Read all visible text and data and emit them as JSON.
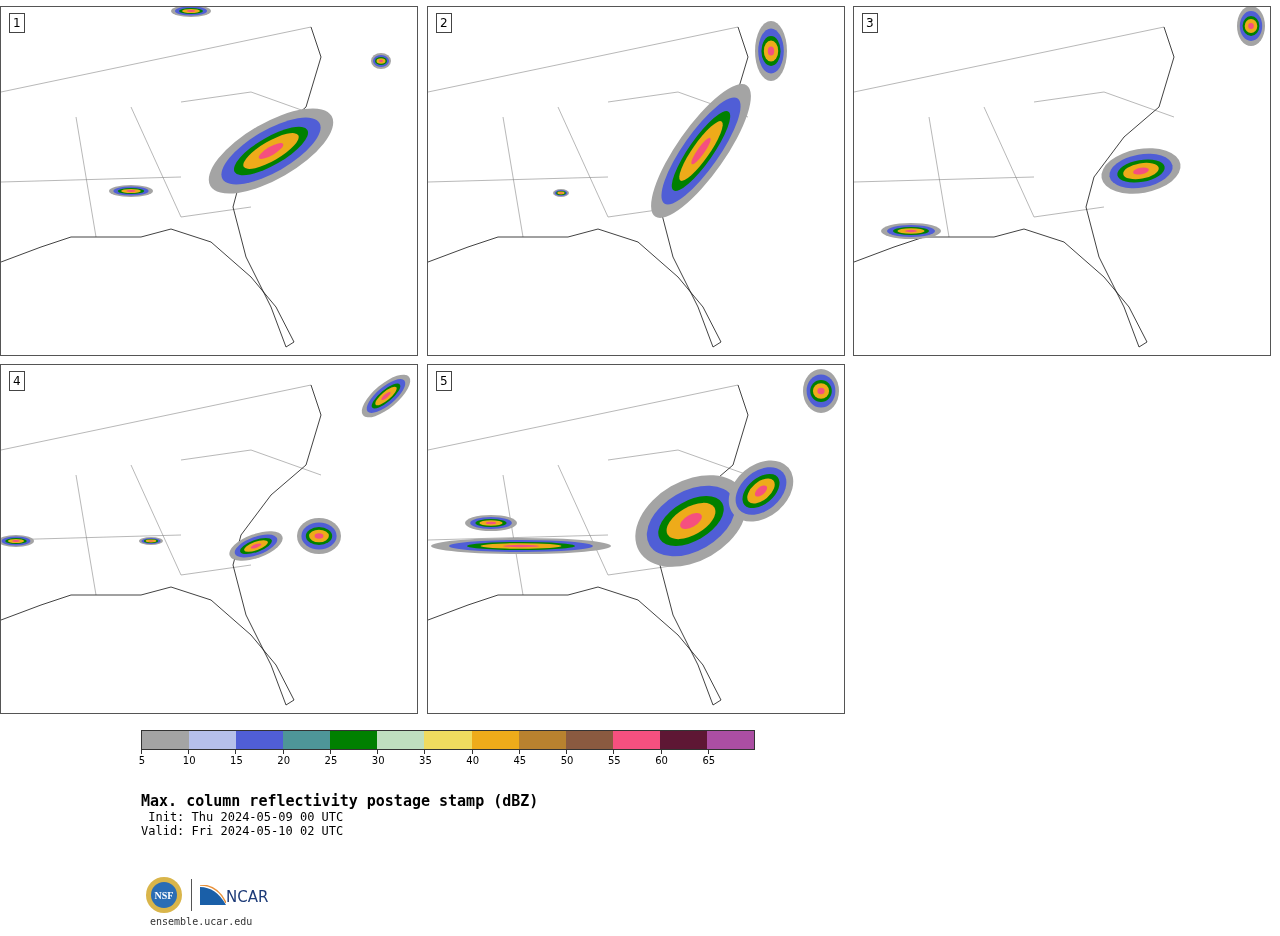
{
  "panels": [
    {
      "label": "1"
    },
    {
      "label": "2"
    },
    {
      "label": "3"
    },
    {
      "label": "4"
    },
    {
      "label": "5"
    }
  ],
  "colorbar": [
    {
      "label": "5",
      "color": "#a4a4a4"
    },
    {
      "label": "10",
      "color": "#b6c0ea"
    },
    {
      "label": "15",
      "color": "#505ed6"
    },
    {
      "label": "20",
      "color": "#4e9698"
    },
    {
      "label": "25",
      "color": "#008000"
    },
    {
      "label": "30",
      "color": "#bfdfbf"
    },
    {
      "label": "35",
      "color": "#efdb5f"
    },
    {
      "label": "40",
      "color": "#eeab1a"
    },
    {
      "label": "45",
      "color": "#b8822f"
    },
    {
      "label": "50",
      "color": "#8a5a40"
    },
    {
      "label": "55",
      "color": "#f5507f"
    },
    {
      "label": "60",
      "color": "#5e1734"
    },
    {
      "label": "65",
      "color": "#ab4ea3"
    }
  ],
  "title": "Max. column reflectivity postage stamp (dBZ)",
  "init": " Init: Thu 2024-05-09 00 UTC",
  "valid": "Valid: Fri 2024-05-10 02 UTC",
  "logos": {
    "nsf": "NSF",
    "ncar": "NCAR"
  },
  "footer": "ensemble.ucar.edu"
}
